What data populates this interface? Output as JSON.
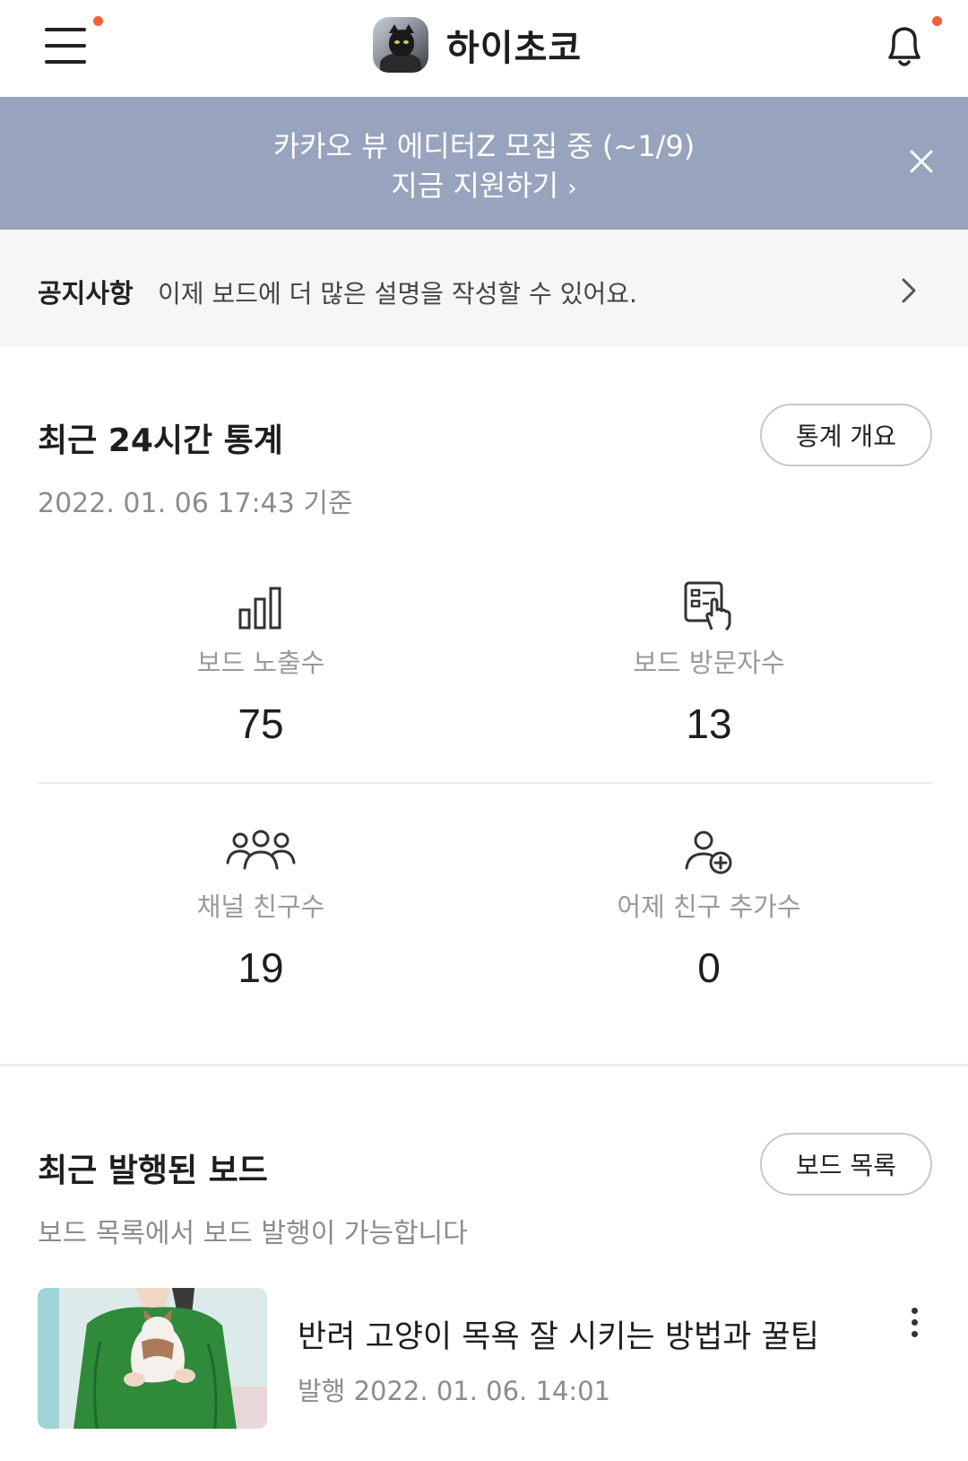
{
  "header": {
    "channel_name": "하이초코",
    "accent_dot_color": "#f2603a"
  },
  "banner": {
    "line1": "카카오 뷰 에디터Z 모집 중 (~1/9)",
    "line2": "지금 지원하기",
    "line2_chevron": "›",
    "bg_color": "#98a3bd"
  },
  "notice": {
    "tag": "공지사항",
    "text": "이제 보드에 더 많은 설명을 작성할 수 있어요."
  },
  "stats": {
    "title": "최근 24시간 통계",
    "button": "통계 개요",
    "basis": "2022. 01. 06 17:43 기준",
    "items": [
      {
        "icon": "bar-chart-icon",
        "label": "보드 노출수",
        "value": "75"
      },
      {
        "icon": "board-tap-icon",
        "label": "보드 방문자수",
        "value": "13"
      },
      {
        "icon": "people-group-icon",
        "label": "채널 친구수",
        "value": "19"
      },
      {
        "icon": "add-friend-icon",
        "label": "어제 친구 추가수",
        "value": "0"
      }
    ]
  },
  "boards": {
    "title": "최근 발행된 보드",
    "button": "보드 목록",
    "subtitle": "보드 목록에서 보드 발행이 가능합니다",
    "items": [
      {
        "title": "반려 고양이 목욕 잘 시키는 방법과 꿀팁",
        "date": "발행 2022. 01. 06. 14:01"
      }
    ]
  }
}
